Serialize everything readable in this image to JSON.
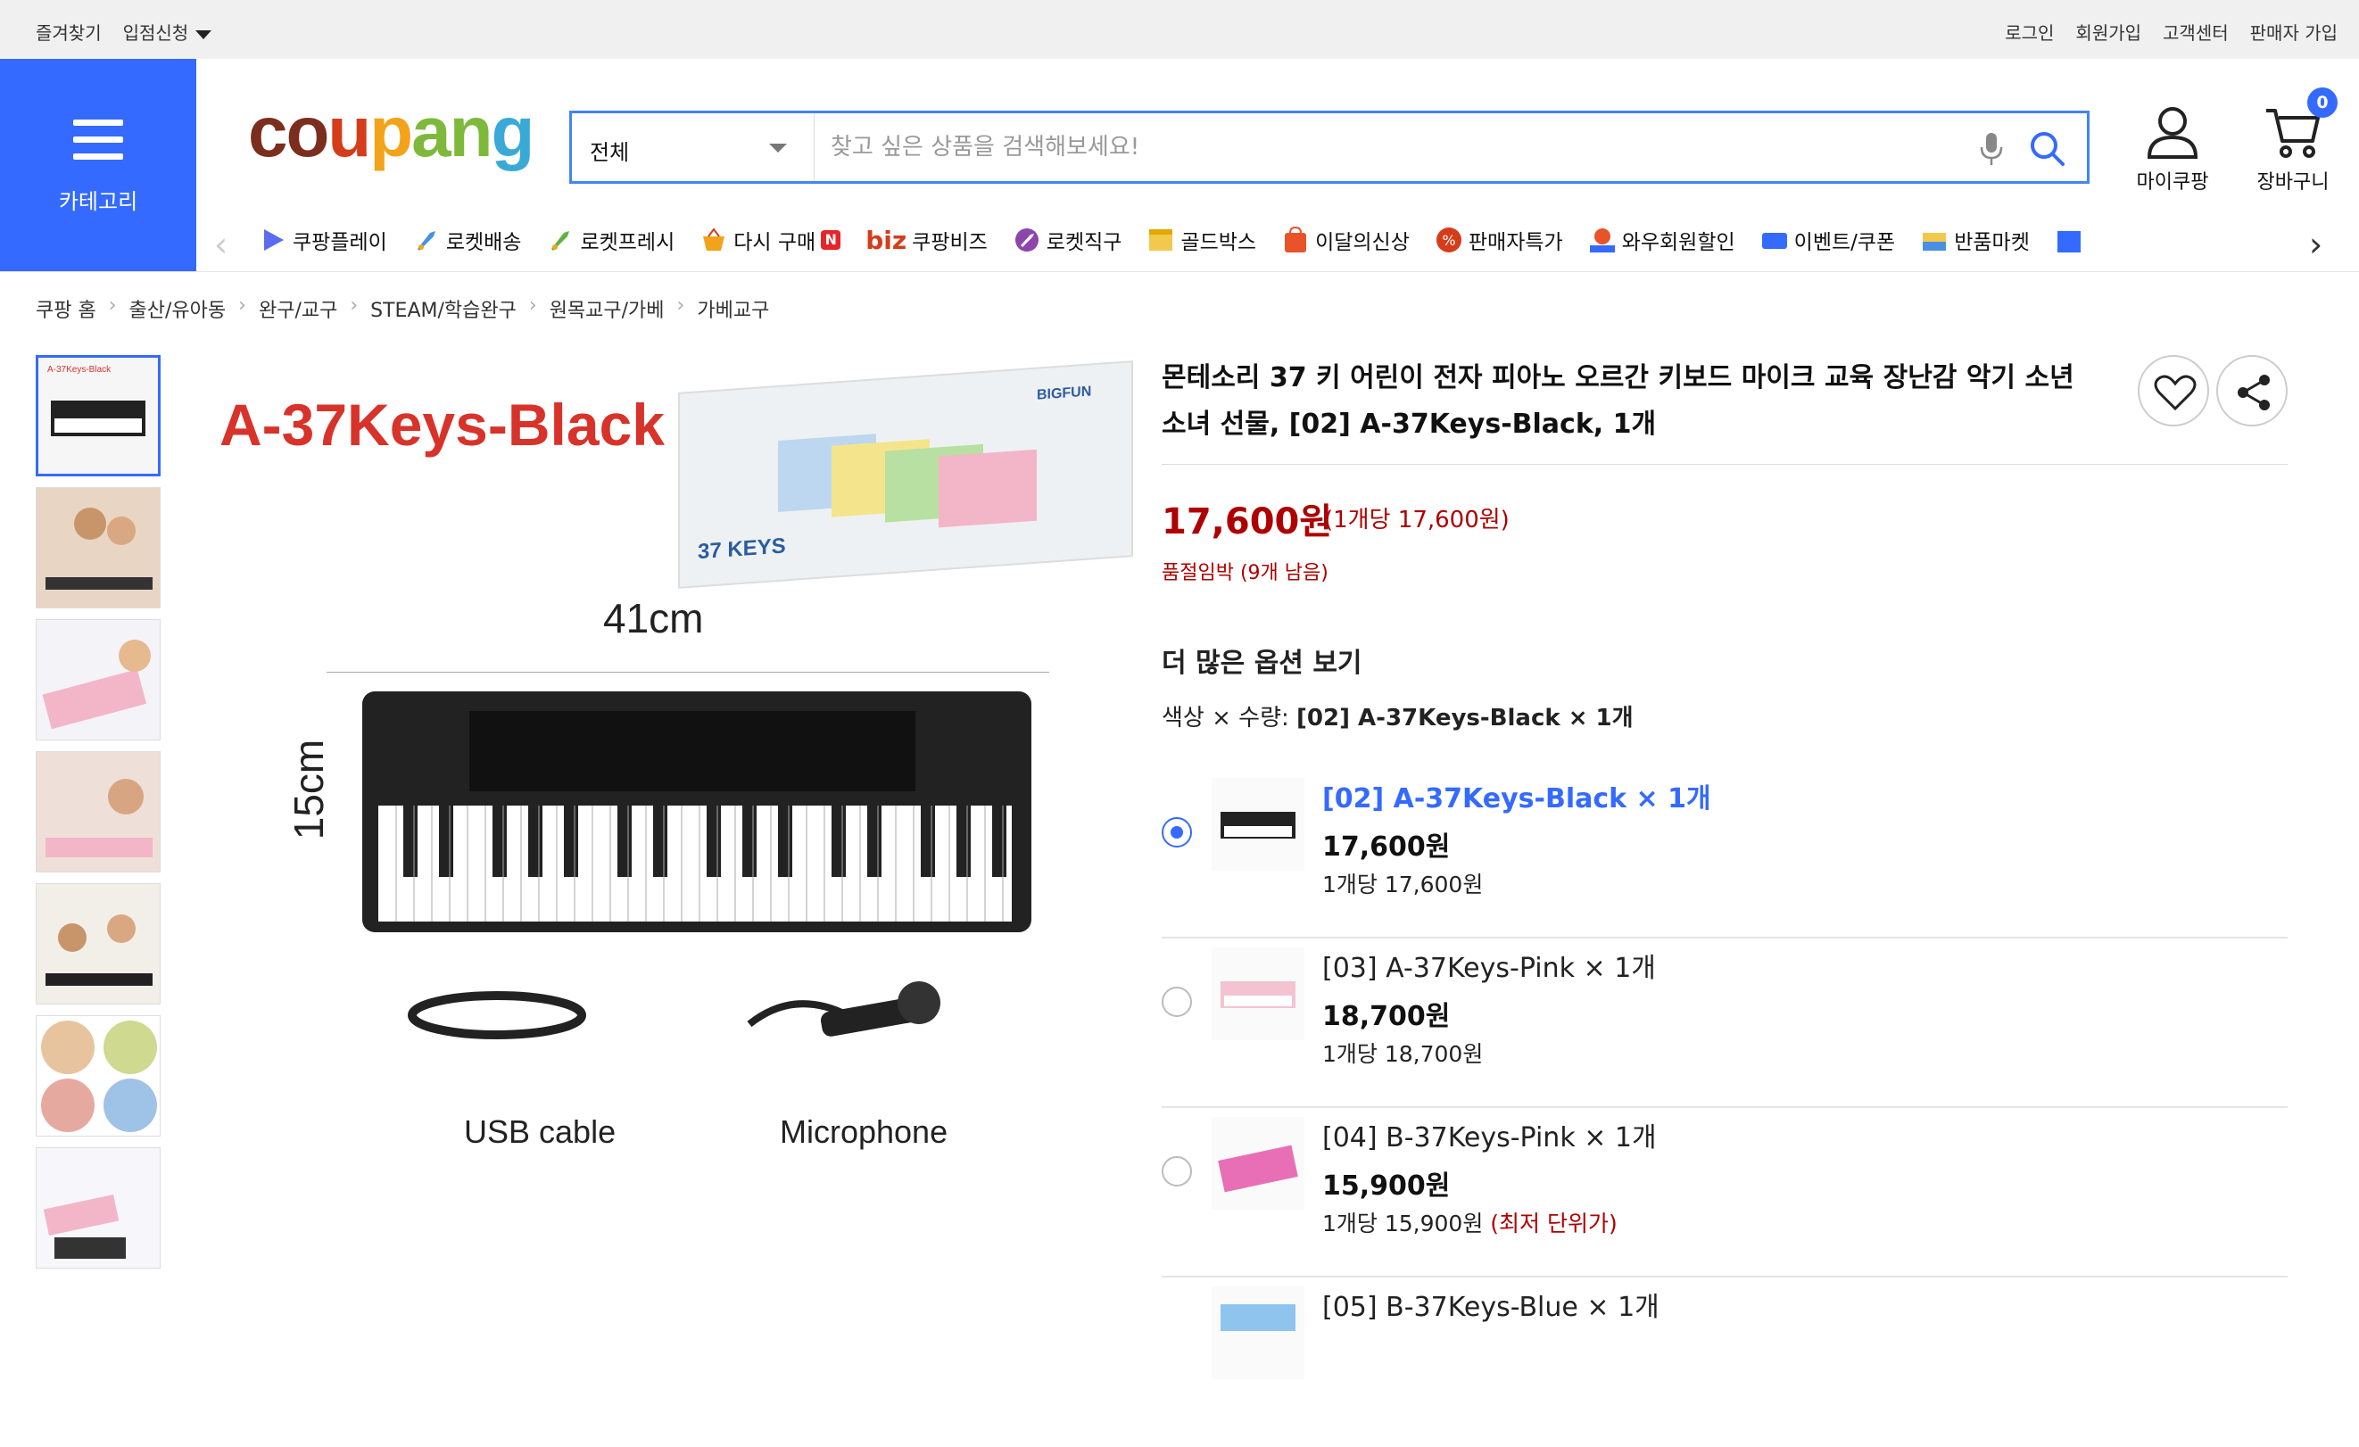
{
  "topbar": {
    "left": [
      "즐겨찾기",
      "입점신청"
    ],
    "right": [
      "로그인",
      "회원가입",
      "고객센터",
      "판매자 가입"
    ]
  },
  "category": {
    "label": "카테고리"
  },
  "logo": {
    "parts": [
      "co",
      "u",
      "p",
      "an",
      "g"
    ]
  },
  "search": {
    "category": "전체",
    "placeholder": "찾고 싶은 상품을 검색해보세요!"
  },
  "header": {
    "my": "마이쿠팡",
    "cart": "장바구니",
    "cart_count": "0"
  },
  "nav": {
    "items": [
      "쿠팡플레이",
      "로켓배송",
      "로켓프레시",
      "다시 구매",
      "쿠팡비즈",
      "로켓직구",
      "골드박스",
      "이달의신상",
      "판매자특가",
      "와우회원할인",
      "이벤트/쿠폰",
      "반품마켓"
    ],
    "biz_prefix": "biz",
    "new_badge": "N"
  },
  "breadcrumb": [
    "쿠팡 홈",
    "출산/유아동",
    "완구/교구",
    "STEAM/학습완구",
    "원목교구/가베",
    "가베교구"
  ],
  "image": {
    "title": "A-37Keys-Black",
    "width_label": "41cm",
    "height_label": "15cm",
    "usb_label": "USB cable",
    "mic_label": "Microphone",
    "box_label": "37 KEYS",
    "brand": "BIGFUN"
  },
  "product": {
    "title": "몬테소리 37 키 어린이 전자 피아노 오르간 키보드 마이크 교육 장난감 악기 소년 소녀 선물, [02] A-37Keys-Black, 1개",
    "price": "17,600원",
    "unit_price": "(1개당 17,600원)",
    "stock": "품절임박 (9개 남음)",
    "more_options": "더 많은 옵션 보기",
    "selection_label": "색상 × 수량:",
    "selection_value": "[02] A-37Keys-Black × 1개"
  },
  "options": [
    {
      "name": "[02] A-37Keys-Black × 1개",
      "price": "17,600원",
      "unit": "1개당 17,600원",
      "extra": "",
      "selected": true
    },
    {
      "name": "[03] A-37Keys-Pink × 1개",
      "price": "18,700원",
      "unit": "1개당 18,700원",
      "extra": "",
      "selected": false
    },
    {
      "name": "[04] B-37Keys-Pink × 1개",
      "price": "15,900원",
      "unit": "1개당 15,900원",
      "extra": "(최저 단위가)",
      "selected": false
    },
    {
      "name": "[05] B-37Keys-Blue × 1개",
      "price": "",
      "unit": "",
      "extra": "",
      "selected": false
    }
  ],
  "colors": {
    "accent": "#346aff",
    "price_red": "#ae0000",
    "brand_red": "#d7332a"
  }
}
